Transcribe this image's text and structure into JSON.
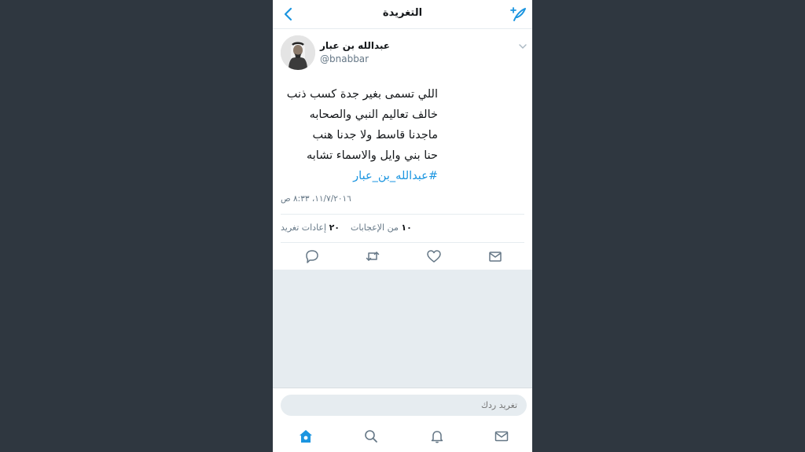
{
  "header": {
    "title": "التغريدة"
  },
  "tweet": {
    "user_name": "عبدالله بن عبار",
    "user_handle": "@bnabbar",
    "lines": [
      "اللي تسمى بغير جدة كسب ذنب",
      "خالف تعاليم النبي والصحابه",
      "ماجدنا قاسط ولا جدنا هنب",
      "حنا بني وايل والاسماء تشابه"
    ],
    "hashtag": "#عبدالله_بن_عبار",
    "timestamp": "١١/٧/٢٠١٦، ٨:٣٣ ص",
    "likes_count": "١٠",
    "likes_label": "من الإعجابات",
    "retweets_count": "٢٠",
    "retweets_label": "إعادات تغريد"
  },
  "reply": {
    "placeholder": "تغريد ردك"
  },
  "colors": {
    "accent": "#1b95e0",
    "background": "#2f3740",
    "feed_gray": "#e6ecf0"
  },
  "icons": {
    "back": "chevron-left-icon",
    "compose": "compose-feather-icon",
    "reply": "reply-bubble-icon",
    "retweet": "retweet-icon",
    "like": "heart-icon",
    "dm": "envelope-icon",
    "home": "home-icon",
    "search": "search-icon",
    "notifications": "bell-icon",
    "messages": "envelope-icon"
  }
}
